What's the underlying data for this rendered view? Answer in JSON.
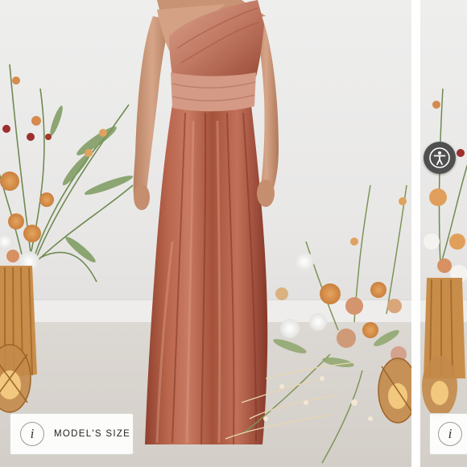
{
  "product_photo": {
    "model_size_button": {
      "icon": "info-icon",
      "glyph": "i",
      "label": "MODEL'S SIZE"
    },
    "next_slide_info": {
      "icon": "info-icon",
      "glyph": "i"
    },
    "accessibility_button": {
      "icon": "accessibility-icon"
    }
  },
  "colors": {
    "dress": "#b8654c",
    "dress_shadow": "#8a3f2c",
    "dress_highlight": "#d69684",
    "button_dark": "#4f4f4f"
  }
}
